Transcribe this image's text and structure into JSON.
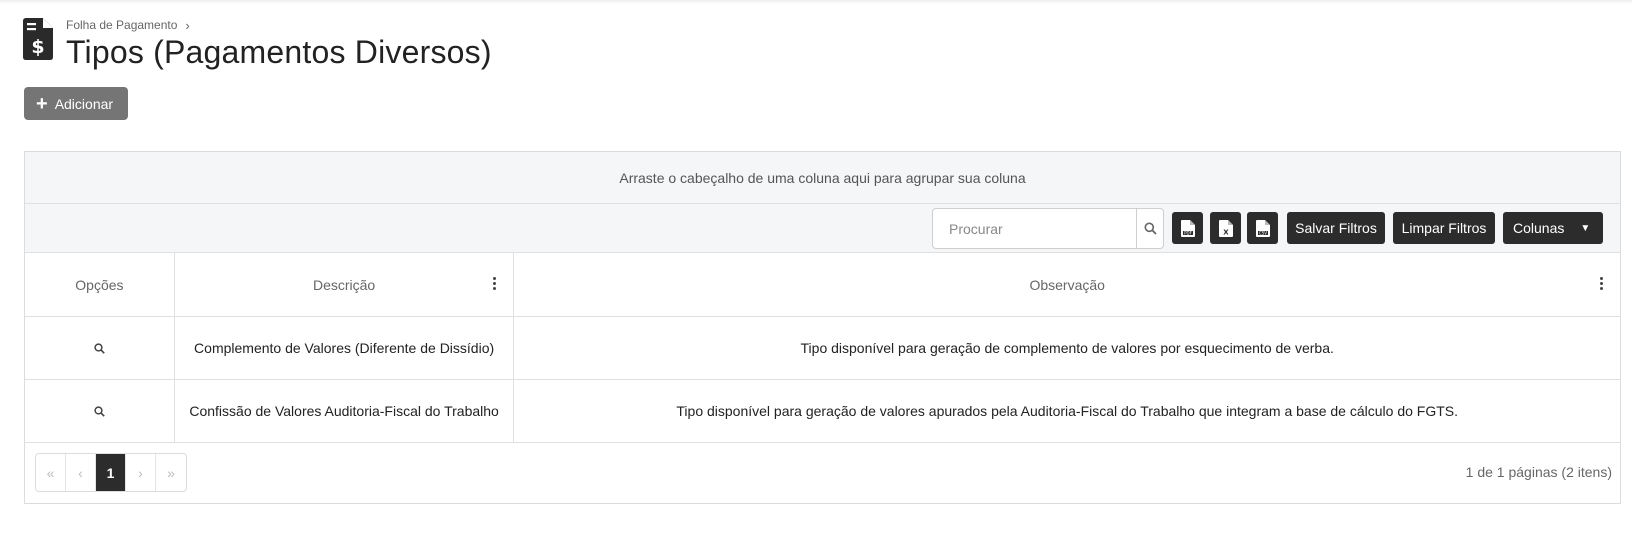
{
  "breadcrumb": {
    "parent": "Folha de Pagamento"
  },
  "page": {
    "title": "Tipos (Pagamentos Diversos)"
  },
  "actions": {
    "add_label": "Adicionar"
  },
  "grid": {
    "group_hint": "Arraste o cabeçalho de uma coluna aqui para agrupar sua coluna",
    "search_placeholder": "Procurar",
    "toolbar": {
      "save_filters": "Salvar Filtros",
      "clear_filters": "Limpar Filtros",
      "columns": "Colunas"
    },
    "columns": [
      "Opções",
      "Descrição",
      "Observação"
    ],
    "rows": [
      {
        "descricao": "Complemento de Valores (Diferente de Dissídio)",
        "observacao": "Tipo disponível para geração de complemento de valores por esquecimento de verba."
      },
      {
        "descricao": "Confissão de Valores Auditoria-Fiscal do Trabalho",
        "observacao": "Tipo disponível para geração de valores apurados pela Auditoria-Fiscal do Trabalho que integram a base de cálculo do FGTS."
      }
    ],
    "pager": {
      "current_page": "1",
      "info": "1 de 1 páginas (2 itens)"
    }
  },
  "icons": {
    "header": "invoice-dollar-icon",
    "add": "plus-icon",
    "search": "search-icon",
    "export_pdf": "pdf-file-icon",
    "export_xls": "excel-file-icon",
    "export_csv": "csv-file-icon",
    "columns": "caret-down-icon",
    "row_view": "magnifier-icon"
  },
  "colors": {
    "dark_button": "#2c2c2c",
    "add_button": "#757575",
    "panel_bg": "#f5f6f8"
  }
}
